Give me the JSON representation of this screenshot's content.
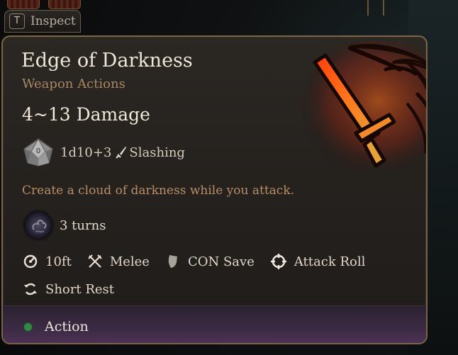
{
  "inspect": {
    "key": "T",
    "label": "Inspect"
  },
  "spell": {
    "name": "Edge of Darkness",
    "category": "Weapon Actions",
    "damage": "4~13 Damage",
    "dice_face": "0",
    "dice_roll": "1d10+3",
    "damage_type": "Slashing",
    "description": "Create a cloud of darkness while you attack.",
    "duration": "3 turns",
    "range": "10ft",
    "attack_type": "Melee",
    "save": "CON Save",
    "roll": "Attack Roll",
    "recharge": "Short Rest",
    "cost": "Action"
  },
  "icons": {
    "dice": "d10-icon",
    "damage_type": "sword-icon",
    "duration": "darkness-cloud-icon",
    "range": "range-gauge-icon",
    "attack_type": "crossed-swords-icon",
    "save": "shield-icon",
    "roll": "crosshair-icon",
    "recharge": "cycle-arrows-icon",
    "cost": "action-dot-icon"
  },
  "colors": {
    "title": "#efe6d9",
    "category": "#a88862",
    "description": "#b98e66",
    "frame": "#7a6348",
    "action_dot": "#2f8a45",
    "spell_glow": "#ff4a10"
  }
}
